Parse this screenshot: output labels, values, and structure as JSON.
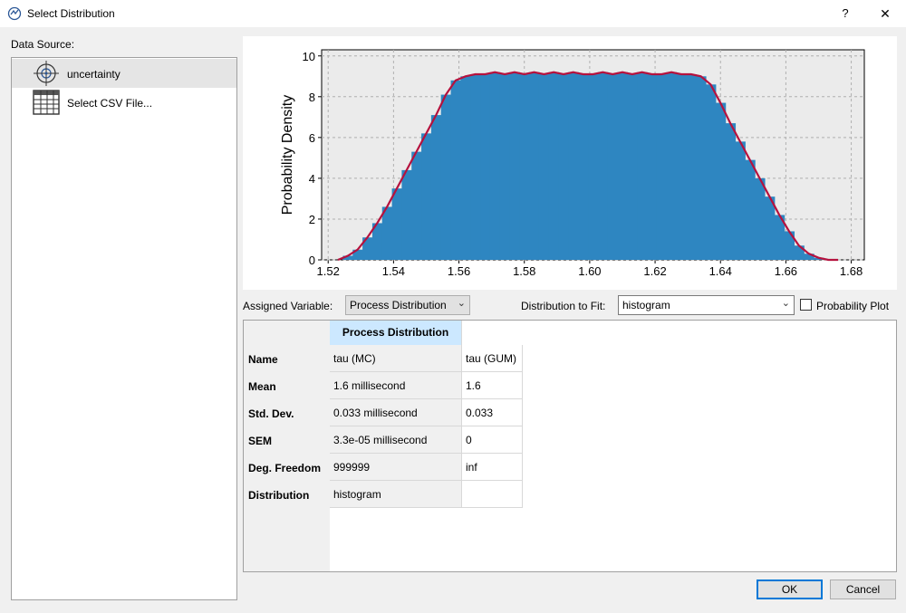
{
  "window": {
    "title": "Select Distribution",
    "help_label": "?",
    "close_label": "✕"
  },
  "data_source": {
    "label": "Data Source:",
    "items": [
      {
        "label": "uncertainty",
        "icon": "target-icon",
        "selected": true
      },
      {
        "label": "Select CSV File...",
        "icon": "table-icon",
        "selected": false
      }
    ]
  },
  "controls": {
    "assigned_variable_label": "Assigned Variable:",
    "assigned_variable_value": "Process Distribution",
    "distribution_to_fit_label": "Distribution to Fit:",
    "distribution_to_fit_value": "histogram",
    "probability_plot_label": "Probability Plot",
    "probability_plot_checked": false
  },
  "table": {
    "column_header": "Process Distribution",
    "rows": [
      {
        "name": "Name",
        "mc": "tau (MC)",
        "gum": "tau (GUM)"
      },
      {
        "name": "Mean",
        "mc": "1.6 millisecond",
        "gum": "1.6"
      },
      {
        "name": "Std. Dev.",
        "mc": "0.033 millisecond",
        "gum": "0.033"
      },
      {
        "name": "SEM",
        "mc": "3.3e-05 millisecond",
        "gum": "0"
      },
      {
        "name": "Deg. Freedom",
        "mc": "999999",
        "gum": "inf"
      },
      {
        "name": "Distribution",
        "mc": "histogram",
        "gum": ""
      }
    ]
  },
  "buttons": {
    "ok": "OK",
    "cancel": "Cancel"
  },
  "chart_data": {
    "type": "bar",
    "ylabel": "Probability Density",
    "xlabel": "",
    "xlim": [
      1.518,
      1.684
    ],
    "ylim": [
      0,
      10.3
    ],
    "xticks": [
      "1.52",
      "1.54",
      "1.56",
      "1.58",
      "1.60",
      "1.62",
      "1.64",
      "1.66",
      "1.68"
    ],
    "yticks": [
      "0",
      "2",
      "4",
      "6",
      "8",
      "10"
    ],
    "grid": true,
    "bar_color": "#2e86c1",
    "line_color": "#b5123e",
    "x": [
      1.523,
      1.526,
      1.529,
      1.532,
      1.535,
      1.538,
      1.541,
      1.544,
      1.547,
      1.55,
      1.553,
      1.556,
      1.559,
      1.562,
      1.565,
      1.568,
      1.571,
      1.574,
      1.577,
      1.58,
      1.583,
      1.586,
      1.589,
      1.592,
      1.595,
      1.598,
      1.601,
      1.604,
      1.607,
      1.61,
      1.613,
      1.616,
      1.619,
      1.622,
      1.625,
      1.628,
      1.631,
      1.634,
      1.637,
      1.64,
      1.643,
      1.646,
      1.649,
      1.652,
      1.655,
      1.658,
      1.661,
      1.664,
      1.667,
      1.67,
      1.673,
      1.676
    ],
    "values": [
      0.0,
      0.2,
      0.5,
      1.1,
      1.8,
      2.6,
      3.5,
      4.4,
      5.3,
      6.2,
      7.1,
      8.1,
      8.8,
      9.0,
      9.1,
      9.1,
      9.2,
      9.1,
      9.2,
      9.1,
      9.2,
      9.1,
      9.2,
      9.1,
      9.2,
      9.1,
      9.1,
      9.2,
      9.1,
      9.2,
      9.1,
      9.2,
      9.1,
      9.1,
      9.2,
      9.1,
      9.1,
      9.0,
      8.6,
      7.7,
      6.7,
      5.8,
      4.9,
      4.0,
      3.1,
      2.2,
      1.4,
      0.7,
      0.3,
      0.1,
      0.0,
      0.0
    ]
  }
}
